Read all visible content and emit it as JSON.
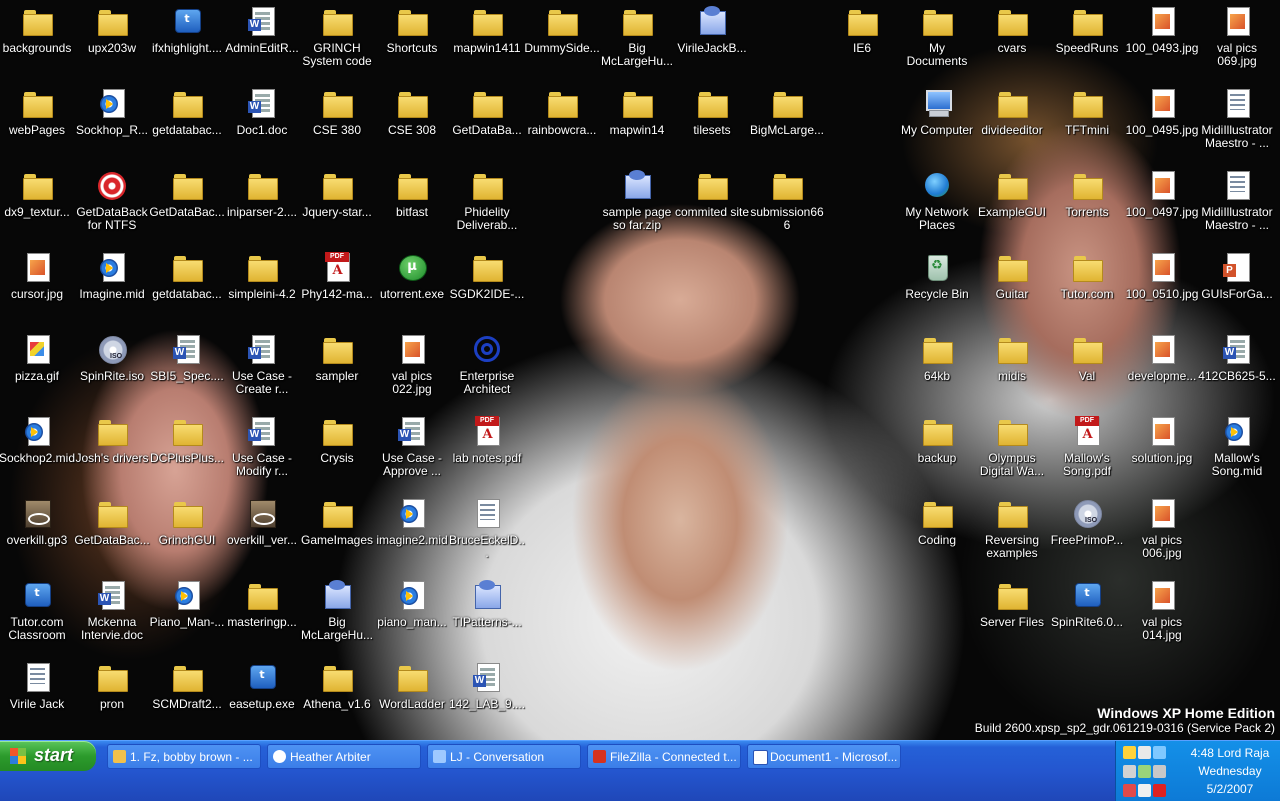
{
  "desktop": {
    "icons": [
      {
        "label": "backgrounds",
        "type": "folder"
      },
      {
        "label": "upx203w",
        "type": "folder"
      },
      {
        "label": "ifxhighlight....",
        "type": "app"
      },
      {
        "label": "AdminEditR...",
        "type": "doc"
      },
      {
        "label": "GRINCH\nSystem code",
        "type": "folder"
      },
      {
        "label": "Shortcuts",
        "type": "folder"
      },
      {
        "label": "mapwin1411",
        "type": "folder"
      },
      {
        "label": "DummySide...",
        "type": "folder"
      },
      {
        "label": "Big\nMcLargeHu...",
        "type": "folder"
      },
      {
        "label": "VirileJackB...",
        "type": "archive"
      },
      {
        "label": "IE6",
        "type": "folder"
      },
      {
        "label": "My Documents",
        "type": "folder"
      },
      {
        "label": "cvars",
        "type": "folder"
      },
      {
        "label": "SpeedRuns",
        "type": "folder"
      },
      {
        "label": "100_0493.jpg",
        "type": "image"
      },
      {
        "label": "val pics\n069.jpg",
        "type": "image"
      },
      {
        "label": "webPages",
        "type": "folder"
      },
      {
        "label": "Sockhop_R...",
        "type": "media"
      },
      {
        "label": "getdatabac...",
        "type": "folder"
      },
      {
        "label": "Doc1.doc",
        "type": "doc"
      },
      {
        "label": "CSE 380",
        "type": "folder"
      },
      {
        "label": "CSE 308",
        "type": "folder"
      },
      {
        "label": "GetDataBa...",
        "type": "folder"
      },
      {
        "label": "rainbowcra...",
        "type": "folder"
      },
      {
        "label": "mapwin14",
        "type": "folder"
      },
      {
        "label": "tilesets",
        "type": "folder"
      },
      {
        "label": "BigMcLarge...",
        "type": "folder"
      },
      {
        "label": "My Computer",
        "type": "computer"
      },
      {
        "label": "divideeditor",
        "type": "folder"
      },
      {
        "label": "TFTmini",
        "type": "folder"
      },
      {
        "label": "100_0495.jpg",
        "type": "image"
      },
      {
        "label": "MidiIllustrator\nMaestro - ...",
        "type": "config"
      },
      {
        "label": "dx9_textur...",
        "type": "folder"
      },
      {
        "label": "GetDataBack\nfor NTFS",
        "type": "target"
      },
      {
        "label": "GetDataBac...",
        "type": "folder"
      },
      {
        "label": "iniparser-2....",
        "type": "folder"
      },
      {
        "label": "Jquery-star...",
        "type": "folder"
      },
      {
        "label": "bitfast",
        "type": "folder"
      },
      {
        "label": "Phidelity\nDeliverab...",
        "type": "folder"
      },
      {
        "label": "sample page\nso far.zip",
        "type": "archive"
      },
      {
        "label": "commited site",
        "type": "folder"
      },
      {
        "label": "submission666",
        "type": "folder"
      },
      {
        "label": "My Network\nPlaces",
        "type": "network"
      },
      {
        "label": "ExampleGUI",
        "type": "folder"
      },
      {
        "label": "Torrents",
        "type": "folder"
      },
      {
        "label": "100_0497.jpg",
        "type": "image"
      },
      {
        "label": "MidiIllustrator\nMaestro - ...",
        "type": "config"
      },
      {
        "label": "cursor.jpg",
        "type": "image"
      },
      {
        "label": "Imagine.mid",
        "type": "media"
      },
      {
        "label": "getdatabac...",
        "type": "folder"
      },
      {
        "label": "simpleini-4.2",
        "type": "folder"
      },
      {
        "label": "Phy142-ma...",
        "type": "pdf"
      },
      {
        "label": "utorrent.exe",
        "type": "exe"
      },
      {
        "label": "SGDK2IDE-...",
        "type": "folder"
      },
      {
        "label": "Recycle Bin",
        "type": "recycle"
      },
      {
        "label": "Guitar",
        "type": "folder"
      },
      {
        "label": "Tutor.com",
        "type": "folder"
      },
      {
        "label": "100_0510.jpg",
        "type": "image"
      },
      {
        "label": "GUIsForGa...",
        "type": "ppt"
      },
      {
        "label": "pizza.gif",
        "type": "gif"
      },
      {
        "label": "SpinRite.iso",
        "type": "disc"
      },
      {
        "label": "SBI5_Spec....",
        "type": "doc"
      },
      {
        "label": "Use Case -\nCreate r...",
        "type": "doc"
      },
      {
        "label": "sampler",
        "type": "folder"
      },
      {
        "label": "val pics\n022.jpg",
        "type": "image"
      },
      {
        "label": "Enterprise\nArchitect",
        "type": "ea"
      },
      {
        "label": "64kb",
        "type": "folder"
      },
      {
        "label": "midis",
        "type": "folder"
      },
      {
        "label": "Val",
        "type": "folder"
      },
      {
        "label": "developme...",
        "type": "image"
      },
      {
        "label": "412CB625-5...",
        "type": "doc"
      },
      {
        "label": "Sockhop2.mid",
        "type": "media"
      },
      {
        "label": "Josh's drivers",
        "type": "folder"
      },
      {
        "label": "DCPlusPlus...",
        "type": "folder"
      },
      {
        "label": "Use Case -\nModify r...",
        "type": "doc"
      },
      {
        "label": "Crysis",
        "type": "folder"
      },
      {
        "label": "Use Case -\nApprove ...",
        "type": "doc"
      },
      {
        "label": "lab notes.pdf",
        "type": "pdf"
      },
      {
        "label": "backup",
        "type": "folder"
      },
      {
        "label": "Olympus\nDigital Wa...",
        "type": "folder"
      },
      {
        "label": "Mallow's\nSong.pdf",
        "type": "pdf"
      },
      {
        "label": "solution.jpg",
        "type": "image"
      },
      {
        "label": "Mallow's\nSong.mid",
        "type": "media"
      },
      {
        "label": "overkill.gp3",
        "type": "game"
      },
      {
        "label": "GetDataBac...",
        "type": "folder"
      },
      {
        "label": "GrinchGUI",
        "type": "folder"
      },
      {
        "label": "overkill_ver...",
        "type": "game"
      },
      {
        "label": "GameImages",
        "type": "folder"
      },
      {
        "label": "imagine2.mid",
        "type": "media"
      },
      {
        "label": "BruceEckelD...",
        "type": "config"
      },
      {
        "label": "Coding",
        "type": "folder"
      },
      {
        "label": "Reversing\nexamples",
        "type": "folder"
      },
      {
        "label": "FreePrimoP...",
        "type": "disc"
      },
      {
        "label": "val pics\n006.jpg",
        "type": "image"
      },
      {
        "label": "Tutor.com\nClassroom",
        "type": "app"
      },
      {
        "label": "Mckenna\nIntervie.doc",
        "type": "doc"
      },
      {
        "label": "Piano_Man-...",
        "type": "media"
      },
      {
        "label": "masteringp...",
        "type": "folder"
      },
      {
        "label": "Big\nMcLargeHu...",
        "type": "archive"
      },
      {
        "label": "piano_man...",
        "type": "media"
      },
      {
        "label": "TIPatterns-...",
        "type": "archive"
      },
      {
        "label": "Server Files",
        "type": "folder"
      },
      {
        "label": "SpinRite6.0...",
        "type": "app"
      },
      {
        "label": "val pics\n014.jpg",
        "type": "image"
      },
      {
        "label": "Virile Jack",
        "type": "config"
      },
      {
        "label": "pron",
        "type": "folder"
      },
      {
        "label": "SCMDraft2...",
        "type": "folder"
      },
      {
        "label": "easetup.exe",
        "type": "app"
      },
      {
        "label": "Athena_v1.6",
        "type": "folder"
      },
      {
        "label": "WordLadder",
        "type": "folder"
      },
      {
        "label": "142_LAB_9....",
        "type": "doc"
      }
    ]
  },
  "os_version": {
    "edition": "Windows XP Home Edition",
    "build": "Build 2600.xpsp_sp2_gdr.061219-0316 (Service Pack 2)"
  },
  "taskbar": {
    "start_label": "start",
    "tasks": [
      {
        "label": "1. Fz, bobby brown - ...",
        "icon": "winamp-icon"
      },
      {
        "label": "Heather Arbiter",
        "icon": "chat-icon"
      },
      {
        "label": "LJ - Conversation",
        "icon": "conversation-icon"
      },
      {
        "label": "FileZilla - Connected t...",
        "icon": "filezilla-icon"
      },
      {
        "label": "Document1 - Microsof...",
        "icon": "word-icon"
      }
    ],
    "clock": {
      "time": "4:48 Lord Raja",
      "day": "Wednesday",
      "date": "5/2/2007"
    }
  }
}
